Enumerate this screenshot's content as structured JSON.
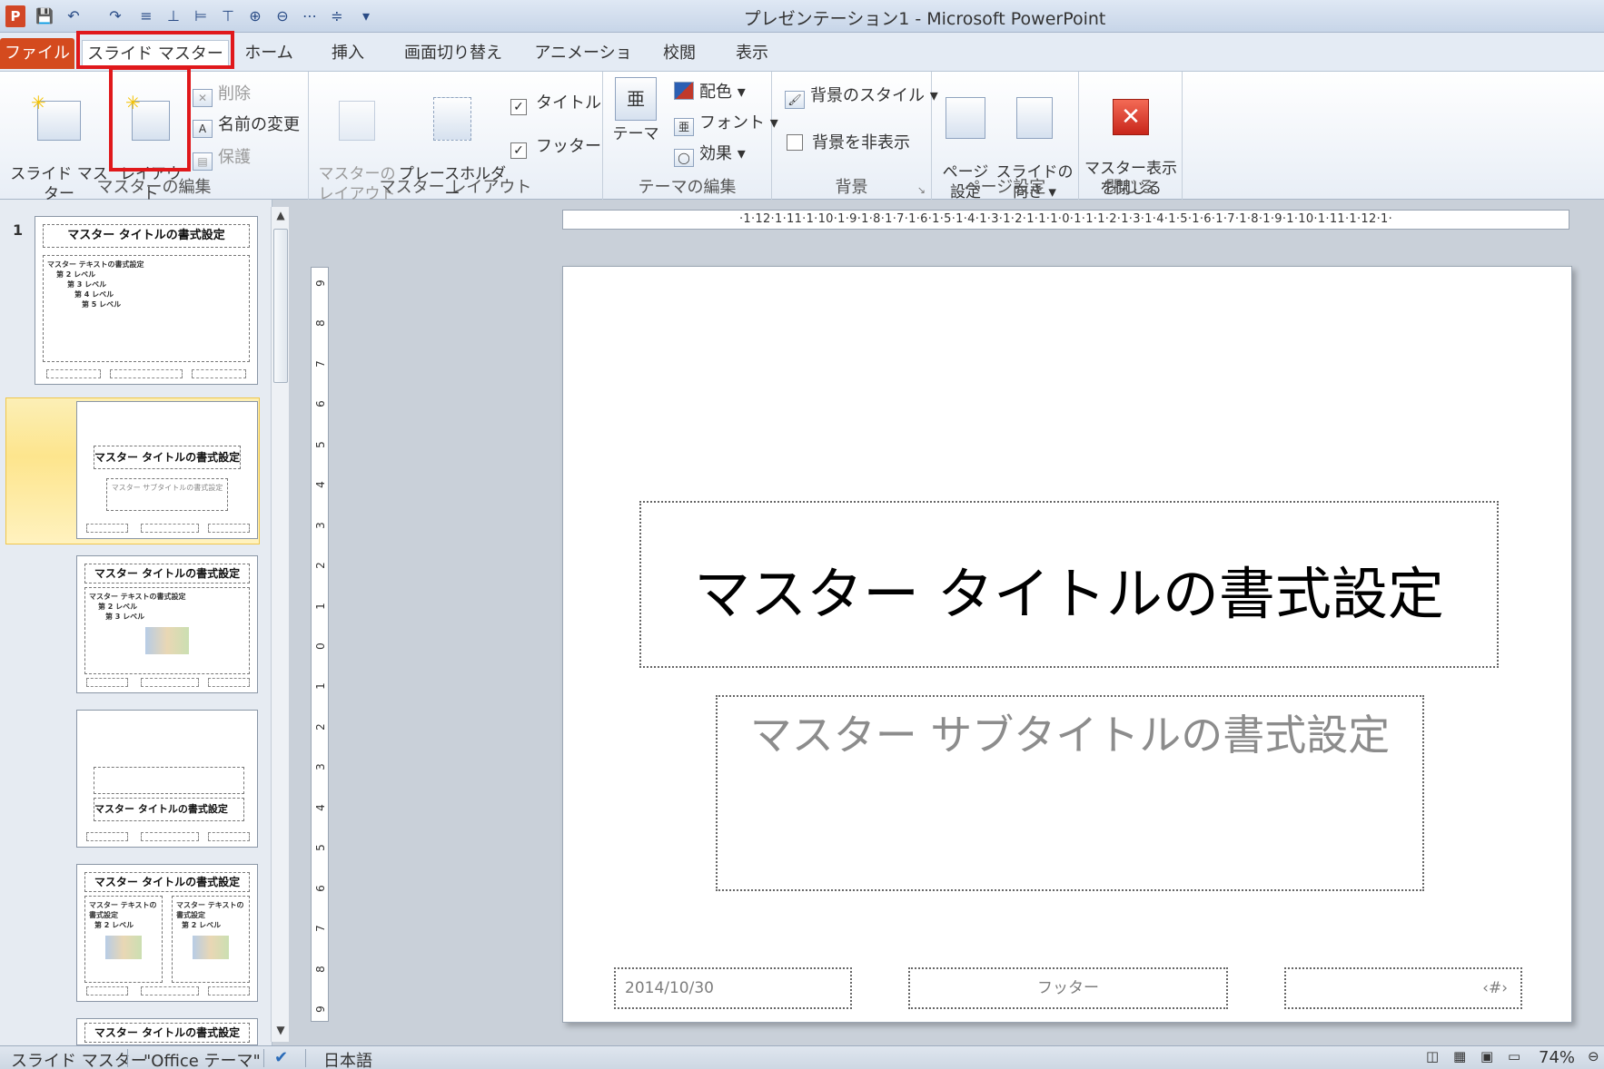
{
  "window": {
    "title": "プレゼンテーション1 - Microsoft PowerPoint",
    "app_icon": "P"
  },
  "quick_access": [
    "save-icon",
    "undo-icon",
    "redo-icon",
    "align-icon",
    "customize-icon"
  ],
  "tabs": [
    {
      "label": "ファイル"
    },
    {
      "label": "スライド マスター"
    },
    {
      "label": "ホーム"
    },
    {
      "label": "挿入"
    },
    {
      "label": "画面切り替え"
    },
    {
      "label": "アニメーション"
    },
    {
      "label": "校閲"
    },
    {
      "label": "表示"
    }
  ],
  "ribbon": {
    "edit_master": {
      "label": "マスターの編集",
      "insert_slide_master": "スライド マスター\nの挿入",
      "insert_layout": "レイアウト\nの挿入",
      "delete": "削除",
      "rename": "名前の変更",
      "preserve": "保護"
    },
    "master_layout": {
      "label": "マスター レイアウト",
      "master_layout_btn": "マスターの\nレイアウト",
      "insert_placeholder": "プレースホルダー\nの挿入 ▾",
      "title_check": "タイトル",
      "footer_check": "フッター"
    },
    "edit_theme": {
      "label": "テーマの編集",
      "themes": "テーマ",
      "colors": "配色 ▾",
      "fonts": "フォント ▾",
      "effects": "効果 ▾"
    },
    "background": {
      "label": "背景",
      "styles": "背景のスタイル ▾",
      "hide": "背景を非表示"
    },
    "page_setup": {
      "label": "ページ設定",
      "setup": "ページ\n設定",
      "orientation": "スライドの\n向き ▾"
    },
    "close": {
      "label": "閉じる",
      "close_master": "マスター表示\nを閉じる"
    }
  },
  "thumbnails": {
    "number": "1",
    "master_title": "マスター タイトルの書式設定",
    "master_text": "マスター テキストの書式設定",
    "subtitle": "マスター サブタイトルの書式設定",
    "level2": "第 2 レベル",
    "level3": "第 3 レベル",
    "level4": "第 4 レベル",
    "level5": "第 5 レベル"
  },
  "ruler": {
    "horizontal": "·1·12·1·11·1·10·1·9·1·8·1·7·1·6·1·5·1·4·1·3·1·2·1·1·1·0·1·1·1·2·1·3·1·4·1·5·1·6·1·7·1·8·1·9·1·10·1·11·1·12·1·",
    "vertical": [
      "9",
      "8",
      "7",
      "6",
      "5",
      "4",
      "3",
      "2",
      "1",
      "0",
      "1",
      "2",
      "3",
      "4",
      "5",
      "6",
      "7",
      "8",
      "9"
    ]
  },
  "slide": {
    "title": "マスター タイトルの書式設定",
    "subtitle": "マスター サブタイトルの書式設定",
    "date": "2014/10/30",
    "footer": "フッター",
    "number": "‹#›"
  },
  "status": {
    "view": "スライド マスター",
    "theme": "\"Office テーマ\"",
    "language": "日本語",
    "zoom": "74%"
  },
  "colors": {
    "file_tab": "#d44a1e",
    "highlight": "#e0181b",
    "selected_thumb": "#fde58d"
  }
}
